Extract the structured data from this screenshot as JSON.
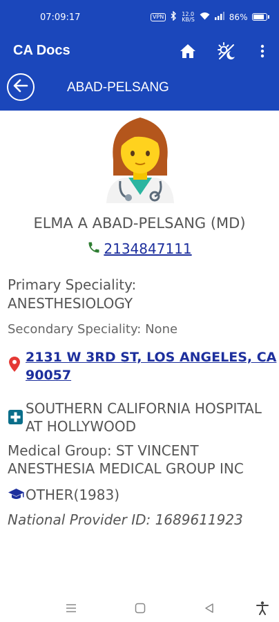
{
  "status_bar": {
    "time": "07:09:17",
    "vpn_badge": "VPN",
    "network_speed_value": "12.0",
    "network_speed_unit": "KB/S",
    "battery_text": "86%",
    "battery_level": 0.86
  },
  "app_bar": {
    "title": "CA Docs",
    "icons": [
      "home-icon",
      "theme-toggle-icon",
      "more-vert-icon"
    ]
  },
  "title_bar": {
    "title": "ABAD-PELSANG",
    "back_icon": "arrow-left-circle-icon"
  },
  "doctor": {
    "name": "ELMA A ABAD-PELSANG (MD)",
    "phone": "2134847111",
    "primary_label": "Primary Speciality:",
    "primary_value": "ANESTHESIOLOGY",
    "secondary": "Secondary Speciality: None",
    "address_line1": "2131 W 3RD ST, LOS ANGELES, CA",
    "address_line2": "90057",
    "hospital_line1": "SOUTHERN CALIFORNIA HOSPITAL",
    "hospital_line2": "AT HOLLYWOOD",
    "group_line1": "Medical Group: ST VINCENT",
    "group_line2": "ANESTHESIA MEDICAL GROUP INC",
    "education": "OTHER(1983)",
    "npi": "National Provider ID: 1689611923"
  },
  "colors": {
    "primary": "#1b47bb",
    "link": "#1d2f9d",
    "phone_icon": "#2e7d32",
    "pin": "#e53935",
    "hospital_icon": "#0a6e8a",
    "education_icon": "#1d2f9d"
  },
  "nav_bar": {
    "icons": [
      "menu-lines-icon",
      "home-square-icon",
      "back-triangle-icon",
      "accessibility-icon"
    ]
  }
}
